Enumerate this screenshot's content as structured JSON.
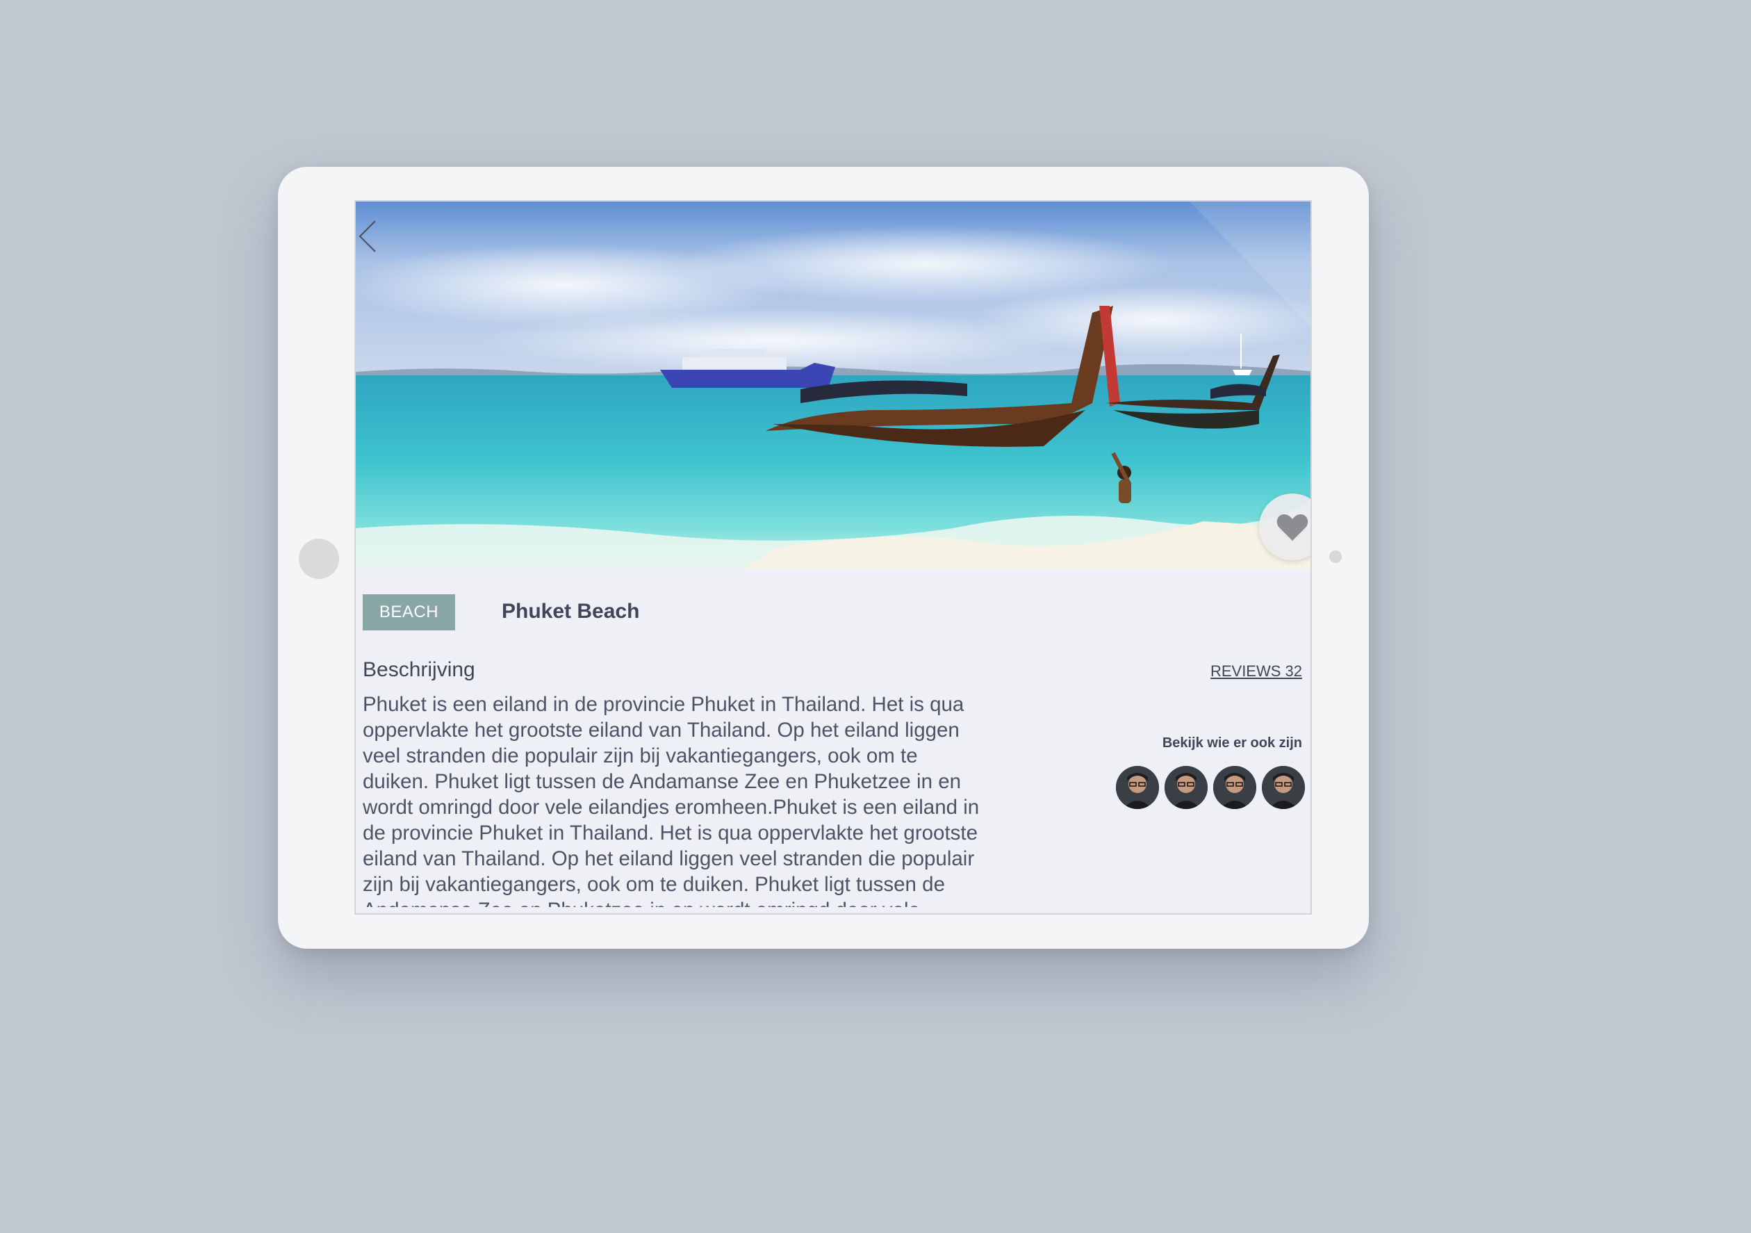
{
  "colors": {
    "background": "#c0c7d1",
    "tablet": "#f4f5f6",
    "screen": "#eff0f5",
    "badge": "#89a6a6",
    "text_dark": "#3f4659",
    "text_body": "#4c5366"
  },
  "hero": {
    "back_icon": "chevron-left-icon",
    "favorite_icon": "heart-icon"
  },
  "place": {
    "category": "BEACH",
    "title": "Phuket Beach"
  },
  "description": {
    "heading": "Beschrijving",
    "text": "Phuket is een eiland in de provincie Phuket in Thailand. Het is qua oppervlakte het grootste eiland van Thailand. Op het eiland liggen veel stranden die populair zijn bij vakantiegangers, ook om te duiken. Phuket ligt tussen de Andamanse Zee en Phuketzee in en wordt omringd door vele eilandjes eromheen.Phuket is een eiland in de provincie Phuket in Thailand. Het is qua oppervlakte het grootste eiland van Thailand. Op het eiland liggen veel stranden die populair zijn bij vakantiegangers, ook om te duiken. Phuket ligt tussen de Andamanse Zee en Phuketzee in en wordt omringd door vele eilandjes eromheen."
  },
  "reviews": {
    "label": "REVIEWS 32"
  },
  "visitors": {
    "label": "Bekijk wie er ook zijn",
    "avatars": [
      "avatar",
      "avatar",
      "avatar",
      "avatar"
    ]
  }
}
